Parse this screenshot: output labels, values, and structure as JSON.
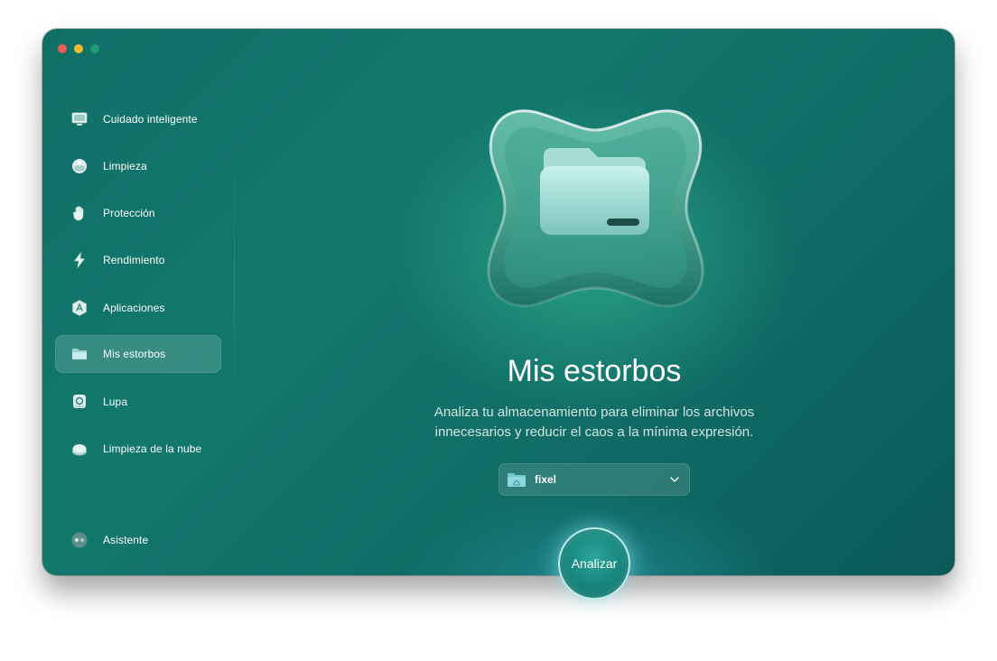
{
  "window": {
    "traffic_lights": [
      "close",
      "minimize",
      "zoom"
    ]
  },
  "sidebar": {
    "items": [
      {
        "label": "Cuidado inteligente",
        "icon": "monitor-icon"
      },
      {
        "label": "Limpieza",
        "icon": "cleanup-ball-icon"
      },
      {
        "label": "Protección",
        "icon": "hand-icon"
      },
      {
        "label": "Rendimiento",
        "icon": "lightning-icon"
      },
      {
        "label": "Aplicaciones",
        "icon": "apps-icon"
      },
      {
        "label": "Mis estorbos",
        "icon": "folder-icon",
        "active": true
      },
      {
        "label": "Lupa",
        "icon": "magnifier-disk-icon"
      },
      {
        "label": "Limpieza de la nube",
        "icon": "cloud-icon"
      }
    ],
    "assistant": {
      "label": "Asistente",
      "icon": "assistant-icon"
    }
  },
  "main": {
    "title": "Mis estorbos",
    "description_line1": "Analiza tu almacenamiento para eliminar los archivos",
    "description_line2": "innecesarios y reducir el caos a la mínima expresión.",
    "folder_select": {
      "value": "fixel",
      "icon": "home-folder-icon"
    },
    "scan_button": "Analizar"
  },
  "colors": {
    "accent": "#13786c",
    "sidebar_active": "rgba(255,255,255,0.16)",
    "close": "#ee5d55",
    "minimize": "#f2b931",
    "zoom": "#2fbf8a"
  }
}
